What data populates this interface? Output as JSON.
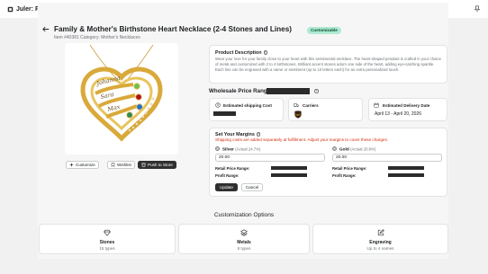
{
  "window": {
    "title": "Juler: Product"
  },
  "product": {
    "title": "Family & Mother's Birthstone Heart Necklace (2-4 Stones and Lines)",
    "badge": "Customizable",
    "item_line": "Item #40381 Category: Mother's Necklaces",
    "engraving_names": [
      "Johanna",
      "Sara",
      "Max"
    ]
  },
  "actions": {
    "customize": "Customize",
    "wishlist": "Wishlist",
    "push": "Push to Store"
  },
  "description": {
    "heading": "Product Description",
    "text": "Wear your love for your family close to your heart with this sentimental necklace. The heart-shaped pendant is crafted in your choice of metal and customized with 2 to 4 birthstones. Brilliant accent stones adorn one side of the heart, adding eye-catching sparkle. Each line can be engraved with a name or sentiment (up to 10 letters each) for an extra personalized touch."
  },
  "wholesale": {
    "label": "Wholesale Price Range:"
  },
  "shipping": {
    "heading": "Estimated shipping Cost"
  },
  "carriers": {
    "heading": "Carriers",
    "logo_text": "ups"
  },
  "delivery": {
    "heading": "Estimated Delivery Date",
    "range": "April 13 - April 20, 2026"
  },
  "margins": {
    "heading": "Set Your Margins",
    "warning": "Shipping costs are added separately at fulfillment. Adjust your margins to cover these charges.",
    "silver": {
      "label": "Silver",
      "actual": "(Actual 24.7%)",
      "value": "20.00",
      "retail_label": "Retail Price Range:",
      "profit_label": "Profit Range:"
    },
    "gold": {
      "label": "Gold",
      "actual": "(Actual 20.8%)",
      "value": "20.00",
      "retail_label": "Retail Price Range:",
      "profit_label": "Profit Range:"
    },
    "update": "Update",
    "cancel": "Cancel"
  },
  "customization": {
    "title": "Customization Options",
    "options": [
      {
        "title": "Stones",
        "sub": "15 types",
        "icon": "diamond-icon"
      },
      {
        "title": "Metals",
        "sub": "8 types",
        "icon": "layers-icon"
      },
      {
        "title": "Engraving",
        "sub": "Up to 4 names",
        "icon": "edit-icon"
      }
    ]
  },
  "colors": {
    "badge_bg": "#aee9d1",
    "warning": "#d72c0d",
    "primary_button": "#303030",
    "gold": "#d9a93a"
  }
}
